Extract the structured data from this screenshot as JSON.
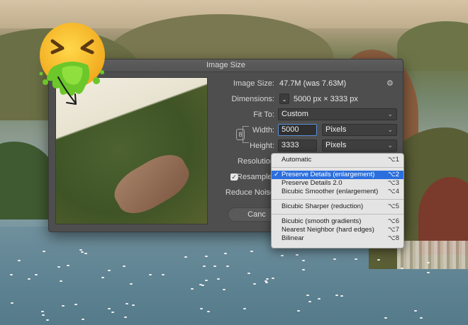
{
  "dialog": {
    "title": "Image Size",
    "image_size_label": "Image Size:",
    "image_size_value": "47.7M (was 7.63M)",
    "dimensions_label": "Dimensions:",
    "dimensions_value": "5000 px  ×  3333 px",
    "fit_to_label": "Fit To:",
    "fit_to_value": "Custom",
    "width_label": "Width:",
    "width_value": "5000",
    "width_unit": "Pixels",
    "height_label": "Height:",
    "height_value": "3333",
    "height_unit": "Pixels",
    "resolution_label": "Resolution",
    "resample_label": "Resample:",
    "reduce_noise_label": "Reduce Noise",
    "cancel_label": "Canc",
    "check_mark": "✓",
    "chevron": "⌄",
    "link_glyph": "8",
    "gear_glyph": "⚙"
  },
  "menu": {
    "items": [
      {
        "label": "Automatic",
        "shortcut": "⌥1"
      },
      {
        "label": "Preserve Details (enlargement)",
        "shortcut": "⌥2",
        "selected": true,
        "check": "✓"
      },
      {
        "label": "Preserve Details 2.0",
        "shortcut": "⌥3"
      },
      {
        "label": "Bicubic Smoother (enlargement)",
        "shortcut": "⌥4"
      },
      {
        "label": "Bicubic Sharper (reduction)",
        "shortcut": "⌥5"
      },
      {
        "label": "Bicubic (smooth gradients)",
        "shortcut": "⌥6"
      },
      {
        "label": "Nearest Neighbor (hard edges)",
        "shortcut": "⌥7"
      },
      {
        "label": "Bilinear",
        "shortcut": "⌥8"
      }
    ]
  },
  "icons": {
    "emoji": "nauseated-vomiting-face-icon",
    "arrow": "arrow-down-right-icon",
    "gear": "gear-icon",
    "link": "chain-link-icon"
  }
}
